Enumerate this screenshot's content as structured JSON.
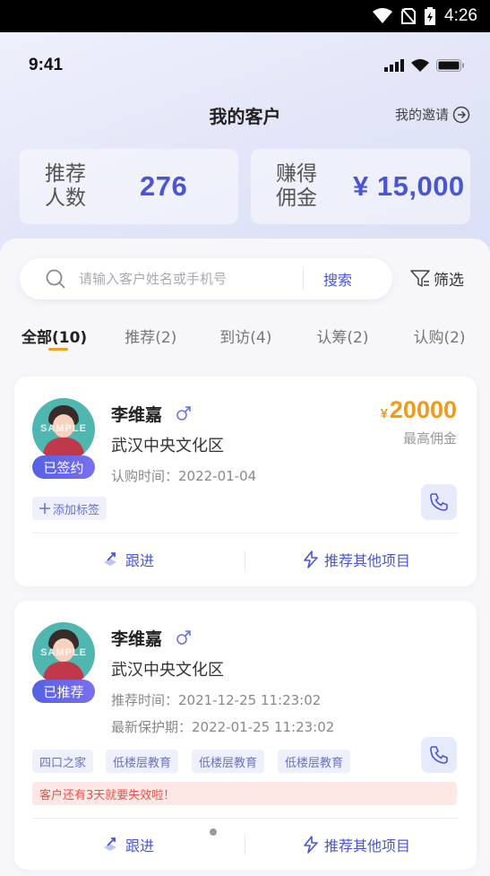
{
  "system_bar": {
    "time": "4:26"
  },
  "ios_bar": {
    "time": "9:41"
  },
  "header": {
    "title": "我的客户",
    "invite_label": "我的邀请"
  },
  "stats": {
    "recommend_label": "推荐人数",
    "recommend_value": "276",
    "commission_label": "赚得佣金",
    "commission_value": "¥ 15,000"
  },
  "search": {
    "placeholder": "请输入客户姓名或手机号",
    "button_label": "搜索",
    "filter_label": "筛选"
  },
  "tabs": [
    {
      "label": "全部(10)",
      "active": true
    },
    {
      "label": "推荐(2)",
      "active": false
    },
    {
      "label": "到访(4)",
      "active": false
    },
    {
      "label": "认筹(2)",
      "active": false
    },
    {
      "label": "认购(2)",
      "active": false
    }
  ],
  "customers": [
    {
      "name": "李维嘉",
      "project": "武汉中央文化区",
      "status": "已签约",
      "info": [
        "认购时间：2022-01-04"
      ],
      "commission_currency": "¥",
      "commission_amount": "20000",
      "commission_label": "最高佣金",
      "add_tag_label": "添加标签",
      "follow_label": "跟进",
      "recommend_label": "推荐其他项目"
    },
    {
      "name": "李维嘉",
      "project": "武汉中央文化区",
      "status": "已推荐",
      "info": [
        "推荐时间：2021-12-25 11:23:02",
        "最新保护期：2022-01-25 11:23:02"
      ],
      "tags": [
        "四口之家",
        "低楼层教育",
        "低楼层教育",
        "低楼层教育"
      ],
      "warning": "客户还有3天就要失效啦！",
      "follow_label": "跟进",
      "recommend_label": "推荐其他项目"
    }
  ],
  "colors": {
    "accent": "#4a55d6",
    "commission": "#f09a18",
    "warning": "#e9524a"
  }
}
